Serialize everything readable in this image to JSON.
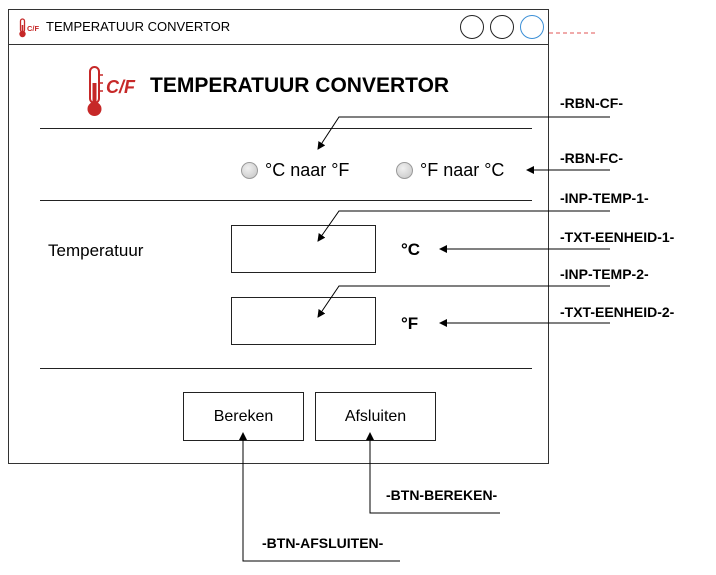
{
  "window": {
    "title": "TEMPERATUUR CONVERTOR",
    "icon": "thermometer-cf-icon",
    "icon_text": "C/F",
    "buttons": [
      "minimize",
      "maximize",
      "close"
    ]
  },
  "header": {
    "title": "TEMPERATUUR CONVERTOR",
    "icon_text": "C/F"
  },
  "radios": [
    {
      "label": "°C naar °F",
      "selected": false
    },
    {
      "label": "°F naar °C",
      "selected": false
    }
  ],
  "form": {
    "label": "Temperatuur",
    "input1": {
      "value": "",
      "unit": "°C"
    },
    "input2": {
      "value": "",
      "unit": "°F"
    }
  },
  "buttons": {
    "calculate": "Bereken",
    "close": "Afsluiten"
  },
  "annotations": {
    "rbn_cf": "-RBN-CF-",
    "rbn_fc": "-RBN-FC-",
    "inp_temp_1": "-INP-TEMP-1-",
    "txt_eenheid_1": "-TXT-EENHEID-1-",
    "inp_temp_2": "-INP-TEMP-2-",
    "txt_eenheid_2": "-TXT-EENHEID-2-",
    "btn_bereken": "-BTN-BEREKEN-",
    "btn_afsluiten": "-BTN-AFSLUITEN-"
  },
  "colors": {
    "icon_red": "#c62828",
    "close_button_blue": "#3b8fd6",
    "dashed_red": "#e05555"
  }
}
